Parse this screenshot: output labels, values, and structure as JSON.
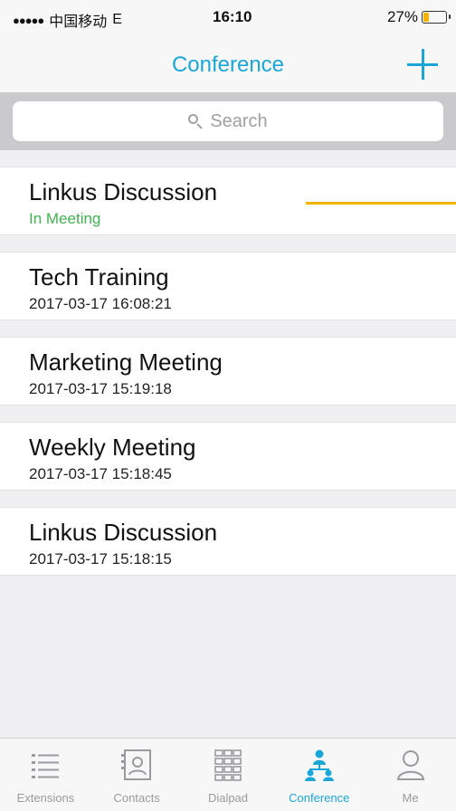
{
  "status_bar": {
    "signal": "●●●●●",
    "carrier": "中国移动",
    "network": "E",
    "time": "16:10",
    "battery_percent": "27%",
    "battery_level": 0.27
  },
  "nav": {
    "title": "Conference",
    "add_icon": "plus-icon"
  },
  "search": {
    "placeholder": "Search"
  },
  "conferences": [
    {
      "title": "Linkus Discussion",
      "subtitle": "In Meeting",
      "status": "in-meeting"
    },
    {
      "title": "Tech Training",
      "subtitle": "2017-03-17 16:08:21"
    },
    {
      "title": "Marketing Meeting",
      "subtitle": "2017-03-17 15:19:18"
    },
    {
      "title": "Weekly Meeting",
      "subtitle": "2017-03-17 15:18:45"
    },
    {
      "title": "Linkus Discussion",
      "subtitle": "2017-03-17 15:18:15"
    }
  ],
  "tabs": [
    {
      "label": "Extensions",
      "icon": "list-icon"
    },
    {
      "label": "Contacts",
      "icon": "contacts-icon"
    },
    {
      "label": "Dialpad",
      "icon": "dialpad-icon"
    },
    {
      "label": "Conference",
      "icon": "conference-icon",
      "active": true
    },
    {
      "label": "Me",
      "icon": "person-icon"
    }
  ],
  "colors": {
    "accent": "#1aa7d8",
    "in_meeting": "#3fb34f",
    "highlight": "#f3b400"
  }
}
